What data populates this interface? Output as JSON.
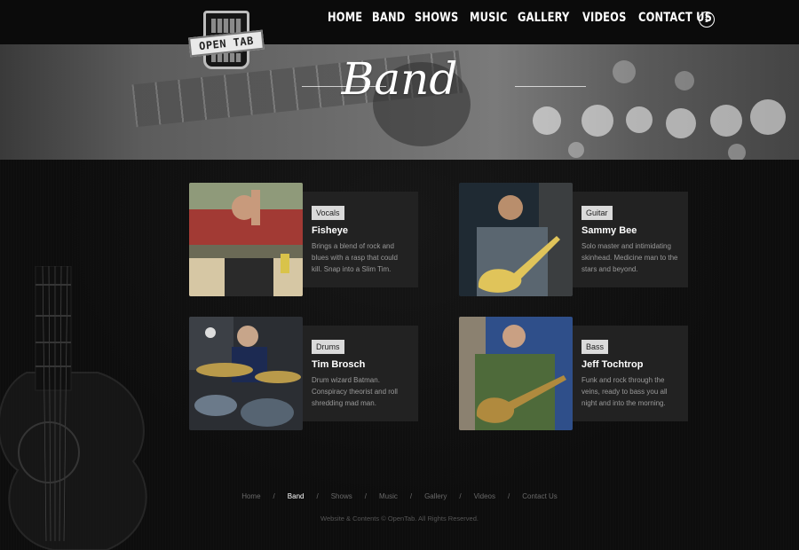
{
  "logo": {
    "text": "OPEN TAB"
  },
  "nav": {
    "items": [
      {
        "label": "HOME"
      },
      {
        "label": "BAND"
      },
      {
        "label": "SHOWS"
      },
      {
        "label": "MUSIC"
      },
      {
        "label": "GALLERY"
      },
      {
        "label": "VIDEOS"
      },
      {
        "label": "CONTACT US"
      }
    ],
    "facebook": "f"
  },
  "hero": {
    "title": "Band"
  },
  "members": [
    {
      "role": "Vocals",
      "name": "Fisheye",
      "bio": "Brings a blend of rock and blues with a rasp that could kill. Snap into a Slim Tim."
    },
    {
      "role": "Guitar",
      "name": "Sammy Bee",
      "bio": "Solo master and intimidating skinhead. Medicine man to the stars and beyond."
    },
    {
      "role": "Drums",
      "name": "Tim Brosch",
      "bio": "Drum wizard Batman. Conspiracy theorist and roll shredding mad man."
    },
    {
      "role": "Bass",
      "name": "Jeff Tochtrop",
      "bio": "Funk and rock through the veins, ready to bass you all night and into the morning."
    }
  ],
  "footer": {
    "links": [
      {
        "label": "Home"
      },
      {
        "label": "Band"
      },
      {
        "label": "Shows"
      },
      {
        "label": "Music"
      },
      {
        "label": "Gallery"
      },
      {
        "label": "Videos"
      },
      {
        "label": "Contact Us"
      }
    ],
    "separator": "/",
    "active": "Band",
    "copyright": "Website & Contents © OpenTab. All Rights Reserved."
  }
}
